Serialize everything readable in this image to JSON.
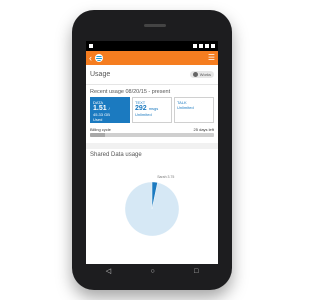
{
  "status": {
    "carrier_icon": "carrier-icon",
    "right_icons": [
      "bluetooth-icon",
      "wifi-icon",
      "signal-icon",
      "battery-icon"
    ]
  },
  "appbar": {
    "back_icon": "‹",
    "menu_icon": "☰",
    "brand_color": "#f57d20"
  },
  "usage": {
    "title": "Usage",
    "toggle_label": "Works"
  },
  "recent": {
    "label": "Recent usage 08/20/15 - present"
  },
  "cards": {
    "data": {
      "label": "DATA",
      "value": "1.51",
      "slash": "/",
      "total": "45.33 GB",
      "unit": "Used"
    },
    "text": {
      "label": "TEXT",
      "value": "292",
      "unit": "msgs",
      "sub": "Unlimited"
    },
    "talk": {
      "label": "TALK",
      "sub": "Unlimited"
    }
  },
  "billing": {
    "label": "Billing cycle",
    "days_left": "25 days left",
    "progress_fraction": 0.12
  },
  "shared": {
    "title": "Shared Data usage"
  },
  "chart_data": {
    "type": "pie",
    "slices": [
      {
        "label": "Sarah 3.75",
        "fraction": 0.033,
        "color": "#1b7ac0"
      },
      {
        "label": "",
        "fraction": 0.967,
        "color": "#d6e8f5"
      }
    ]
  },
  "nav": {
    "back": "◁",
    "home": "○",
    "recent": "□"
  }
}
